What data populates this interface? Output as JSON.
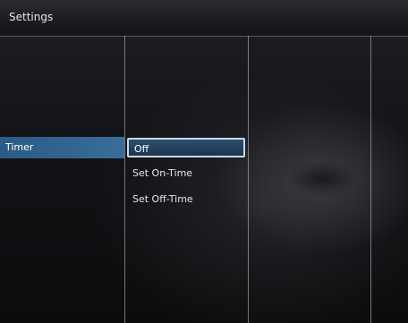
{
  "header": {
    "title": "Settings"
  },
  "left_menu": {
    "items": [
      {
        "label": "Timer",
        "selected": true
      }
    ]
  },
  "submenu": {
    "options": [
      {
        "label": "Off",
        "selected": true
      },
      {
        "label": "Set On-Time",
        "selected": false
      },
      {
        "label": "Set Off-Time",
        "selected": false
      }
    ]
  },
  "colors": {
    "highlight": "#3a6d9a",
    "selection_border": "#cfd8e2",
    "background": "#121316"
  }
}
